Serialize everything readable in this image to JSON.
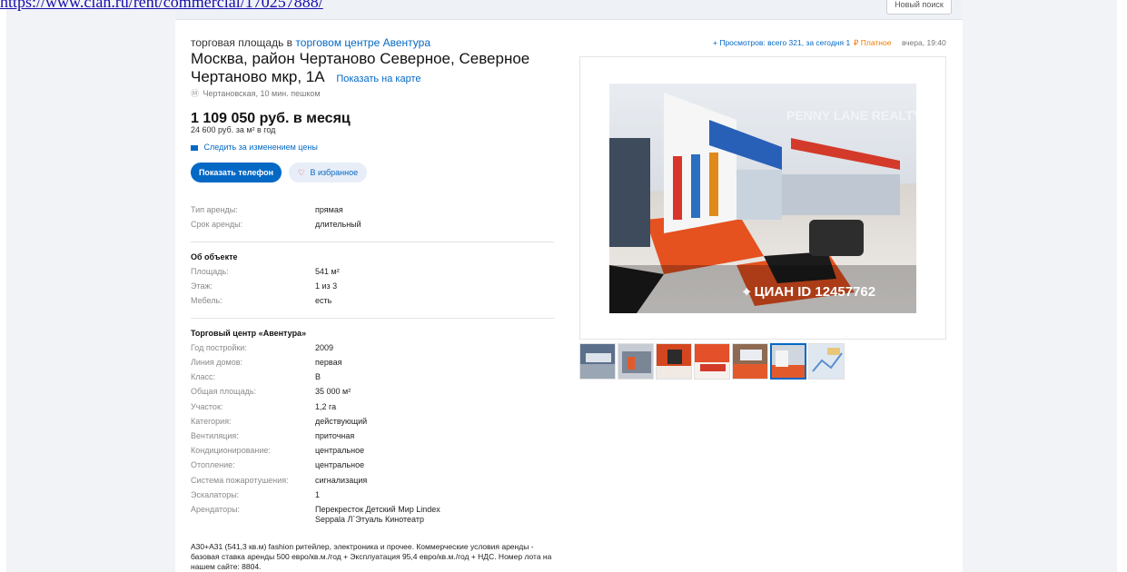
{
  "page_url": "https://www.cian.ru/rent/commercial/170257888/",
  "topbar": {
    "button_label": "Новый поиск"
  },
  "header": {
    "prefix": "торговая площадь в",
    "mall_link": "торговом центре Авентура",
    "address": "Москва, район Чертаново Северное, Северное Чертаново мкр, 1А",
    "map_link": "Показать на карте",
    "metro": "Чертановская, 10 мин. пешком"
  },
  "price": {
    "main": "1 109 050 руб. в месяц",
    "per_m2": "24 600 руб. за м² в год",
    "watch": "Следить за изменением цены"
  },
  "actions": {
    "phone": "Показать телефон",
    "favorite": "В избранное"
  },
  "rent": [
    {
      "k": "Тип аренды:",
      "v": "прямая"
    },
    {
      "k": "Срок аренды:",
      "v": "длительный"
    }
  ],
  "object": {
    "title": "Об объекте",
    "rows": [
      {
        "k": "Площадь:",
        "v": "541 м²"
      },
      {
        "k": "Этаж:",
        "v": "1 из 3"
      },
      {
        "k": "Мебель:",
        "v": "есть"
      }
    ]
  },
  "mall": {
    "title": "Торговый центр «Авентура»",
    "rows": [
      {
        "k": "Год постройки:",
        "v": "2009"
      },
      {
        "k": "Линия домов:",
        "v": "первая"
      },
      {
        "k": "Класс:",
        "v": "B"
      },
      {
        "k": "Общая площадь:",
        "v": "35 000 м²"
      },
      {
        "k": "Участок:",
        "v": "1,2 га"
      },
      {
        "k": "Категория:",
        "v": "действующий"
      },
      {
        "k": "Вентиляция:",
        "v": "приточная"
      },
      {
        "k": "Кондиционирование:",
        "v": "центральное"
      },
      {
        "k": "Отопление:",
        "v": "центральное"
      },
      {
        "k": "Система пожаротушения:",
        "v": "сигнализация"
      },
      {
        "k": "Эскалаторы:",
        "v": "1"
      }
    ],
    "tenants_key": "Арендаторы:",
    "tenants_line1": "Перекресток Детский Мир Lindex",
    "tenants_line2": "Seppala Л`Этуаль Кинотеатр"
  },
  "description": "А30+А31 (541,3 кв.м) fashion ритейлер, электроника и прочее. Коммерческие условия аренды - базовая ставка аренды 500 евро/кв.м./год + Эксплуатация 95,4 евро/кв.м./год + НДС. Номер лота на нашем сайте: 8804.",
  "meta": {
    "views": "Просмотров: всего 321, за сегодня 1",
    "paid": "Платное",
    "date": "вчера, 19:40"
  },
  "photo": {
    "label": "ЦИАН ID 12457762",
    "watermark": "PENNY LANE REALTY"
  },
  "colors": {
    "accent": "#0468c5",
    "paid": "#f07a00",
    "heart": "#e03a3e"
  }
}
